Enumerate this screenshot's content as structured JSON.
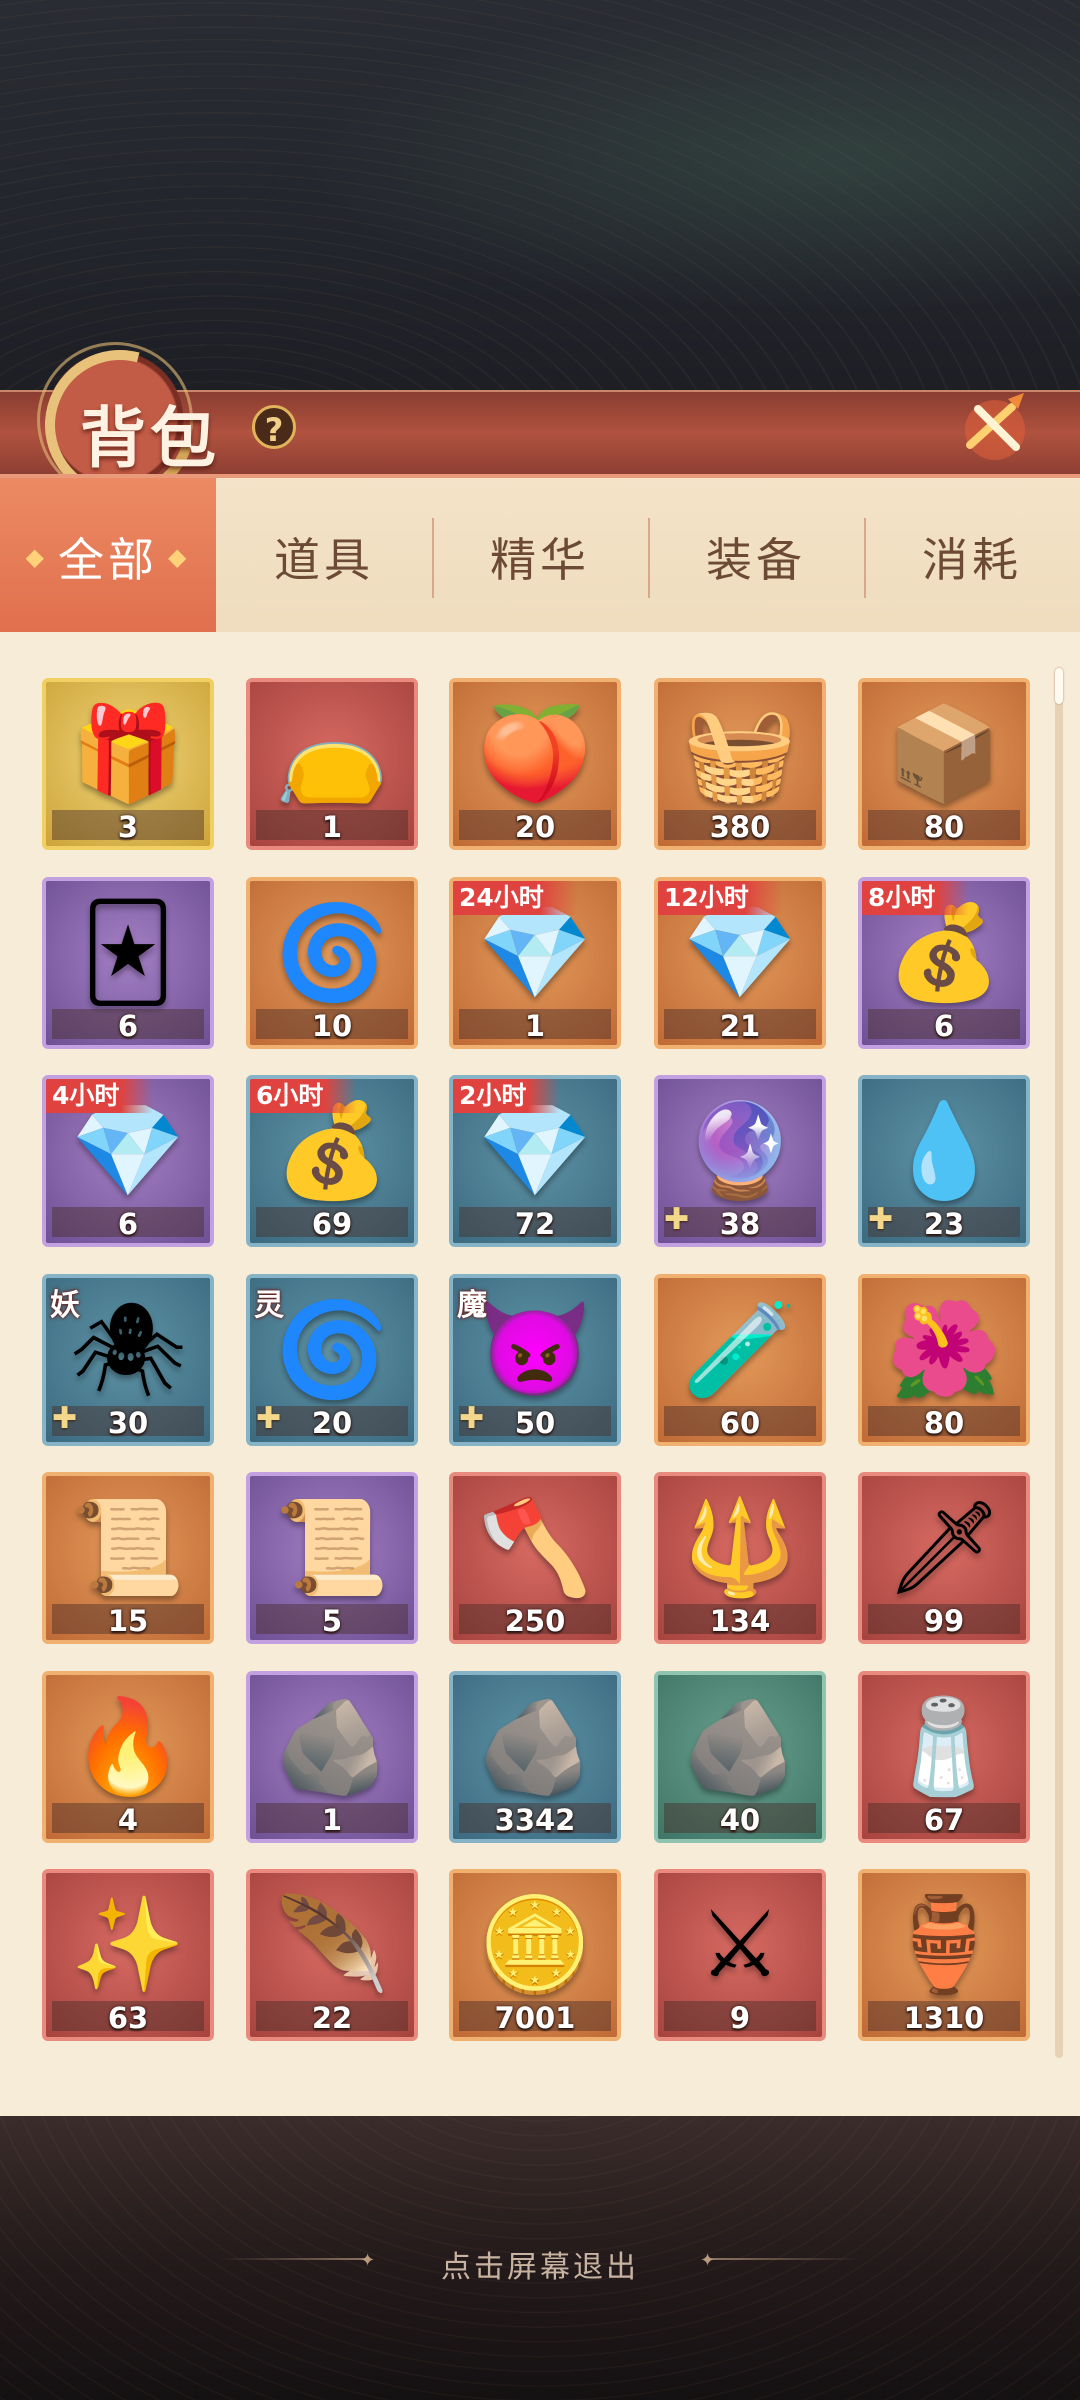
{
  "header": {
    "title": "背包",
    "help_icon": "?",
    "close_icon": "close-icon"
  },
  "tabs": [
    {
      "label": "全部",
      "active": true
    },
    {
      "label": "道具",
      "active": false
    },
    {
      "label": "精华",
      "active": false
    },
    {
      "label": "装备",
      "active": false
    },
    {
      "label": "消耗",
      "active": false
    }
  ],
  "items": [
    {
      "color": "gold",
      "icon": "treasure-chest-icon",
      "art": "🎁",
      "count": "3"
    },
    {
      "color": "red",
      "icon": "blue-pouch-icon",
      "art": "👝",
      "count": "1"
    },
    {
      "color": "orange",
      "icon": "peach-bag-icon",
      "art": "🍑",
      "count": "20"
    },
    {
      "color": "orange",
      "icon": "potion-basket-icon",
      "art": "🧺",
      "count": "380"
    },
    {
      "color": "orange",
      "icon": "gift-box-icon",
      "art": "📦",
      "count": "80"
    },
    {
      "color": "purple",
      "icon": "card-box-icon",
      "art": "🃏",
      "count": "6"
    },
    {
      "color": "orange",
      "icon": "spirit-chest-icon",
      "art": "🌀",
      "count": "10"
    },
    {
      "color": "orange",
      "icon": "jade-chest-icon",
      "art": "💎",
      "count": "1",
      "timer": "24小时"
    },
    {
      "color": "orange",
      "icon": "jade-chest-icon",
      "art": "💎",
      "count": "21",
      "timer": "12小时"
    },
    {
      "color": "purple",
      "icon": "jade-sack-icon",
      "art": "💰",
      "count": "6",
      "timer": "8小时"
    },
    {
      "color": "purple",
      "icon": "jade-crate-icon",
      "art": "💎",
      "count": "6",
      "timer": "4小时"
    },
    {
      "color": "blue",
      "icon": "jade-sack-icon",
      "art": "💰",
      "count": "69",
      "timer": "6小时"
    },
    {
      "color": "blue",
      "icon": "jade-pile-icon",
      "art": "💎",
      "count": "72",
      "timer": "2小时"
    },
    {
      "color": "purple",
      "icon": "purple-flame-icon",
      "art": "🔮",
      "count": "38",
      "puzzle": true
    },
    {
      "color": "blue",
      "icon": "blue-flame-icon",
      "art": "💧",
      "count": "23",
      "puzzle": true
    },
    {
      "color": "blue",
      "icon": "demon-chest-icon",
      "art": "🕷",
      "count": "30",
      "puzzle": true,
      "tag": "妖"
    },
    {
      "color": "blue",
      "icon": "spirit-chest-icon",
      "art": "🌀",
      "count": "20",
      "puzzle": true,
      "tag": "灵"
    },
    {
      "color": "blue",
      "icon": "fiend-chest-icon",
      "art": "👿",
      "count": "50",
      "puzzle": true,
      "tag": "魔"
    },
    {
      "color": "orange",
      "icon": "pink-potion-icon",
      "art": "🧪",
      "count": "60"
    },
    {
      "color": "orange",
      "icon": "red-flower-icon",
      "art": "🌺",
      "count": "80"
    },
    {
      "color": "orange",
      "icon": "gold-scroll-icon",
      "art": "📜",
      "count": "15"
    },
    {
      "color": "purple",
      "icon": "silver-scroll-icon",
      "art": "📜",
      "count": "5"
    },
    {
      "color": "red",
      "icon": "golden-axe-icon",
      "art": "🪓",
      "count": "250"
    },
    {
      "color": "red",
      "icon": "golden-spear-icon",
      "art": "🔱",
      "count": "134"
    },
    {
      "color": "red",
      "icon": "dark-blade-icon",
      "art": "🗡",
      "count": "99"
    },
    {
      "color": "orange",
      "icon": "fire-crystal-icon",
      "art": "🔥",
      "count": "4"
    },
    {
      "color": "purple",
      "icon": "magma-stone-icon",
      "art": "🪨",
      "count": "1"
    },
    {
      "color": "blue",
      "icon": "rune-stone-icon",
      "art": "🪨",
      "count": "3342"
    },
    {
      "color": "green",
      "icon": "spirit-stone-icon",
      "art": "🪨",
      "count": "40"
    },
    {
      "color": "red",
      "icon": "salt-tray-icon",
      "art": "🧂",
      "count": "67"
    },
    {
      "color": "red",
      "icon": "flame-orb-icon",
      "art": "✨",
      "count": "63"
    },
    {
      "color": "red",
      "icon": "phoenix-feather-icon",
      "art": "🪶",
      "count": "22"
    },
    {
      "color": "orange",
      "icon": "gold-ore-icon",
      "art": "🪙",
      "count": "7001"
    },
    {
      "color": "red",
      "icon": "banner-icon",
      "art": "⚔",
      "count": "9"
    },
    {
      "color": "orange",
      "icon": "magic-lamp-icon",
      "art": "🏺",
      "count": "1310"
    }
  ],
  "footer": {
    "exit_hint": "点击屏幕退出"
  },
  "colors": {
    "tab_active": "#e06f4e",
    "timer_badge": "#e0433f",
    "panel_bg": "#f7ecd8",
    "header_bg": "#b0523f"
  }
}
